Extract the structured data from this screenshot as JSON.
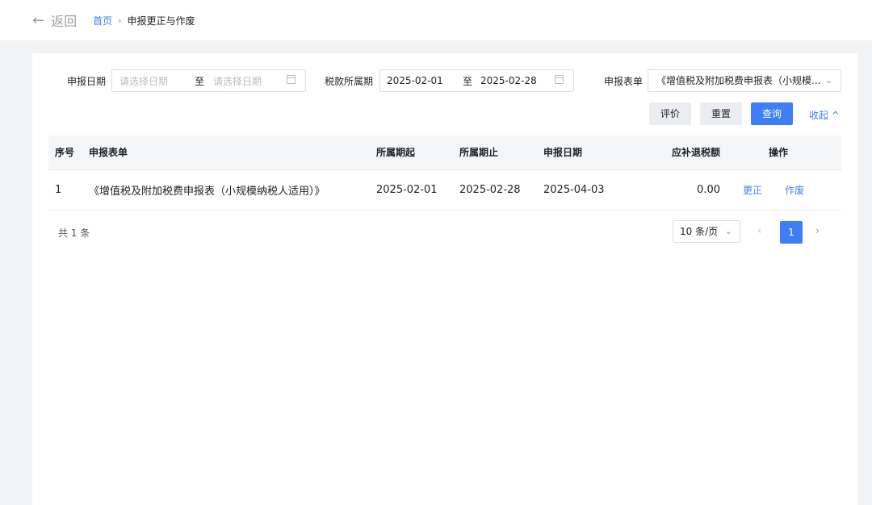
{
  "header": {
    "back_label": "返回",
    "breadcrumb_home": "首页",
    "breadcrumb_sep": "›",
    "breadcrumb_current": "申报更正与作废"
  },
  "filters": {
    "declare_date": {
      "label": "申报日期",
      "from_placeholder": "请选择日期",
      "to_text": "至",
      "to_placeholder": "请选择日期"
    },
    "tax_period": {
      "label": "税款所属期",
      "from": "2025-02-01",
      "to_text": "至",
      "to": "2025-02-28"
    },
    "form": {
      "label": "申报表单",
      "value": "《增值税及附加税费申报表（小规模..."
    }
  },
  "buttons": {
    "evaluate": "评价",
    "reset": "重置",
    "query": "查询",
    "collapse": "收起 ^"
  },
  "table": {
    "headers": [
      "序号",
      "申报表单",
      "所属期起",
      "所属期止",
      "申报日期",
      "应补退税额",
      "操作"
    ],
    "rows": [
      {
        "no": "1",
        "form": "《增值税及附加税费申报表（小规模纳税人适用）》",
        "start": "2025-02-01",
        "end": "2025-02-28",
        "date": "2025-04-03",
        "amount": "0.00",
        "action_correct": "更正",
        "action_void": "作废"
      }
    ]
  },
  "pagination": {
    "total": "共 1 条",
    "page_size": "10 条/页",
    "current_page": "1",
    "prev": "‹",
    "next": "›"
  },
  "colors": {
    "accent": "#3d7ef5",
    "background": "#f2f3f5"
  }
}
